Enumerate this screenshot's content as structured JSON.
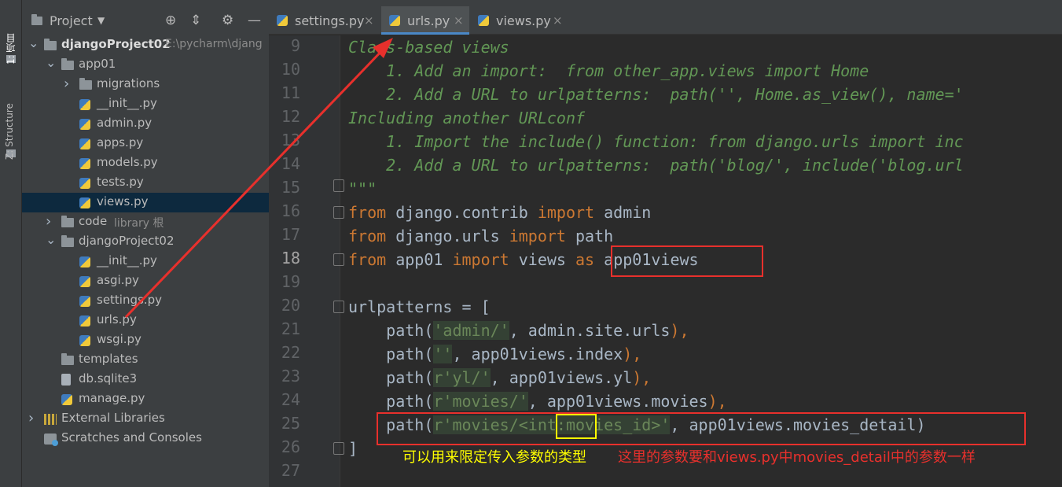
{
  "sidebar_strip": {
    "project_tab": "1: 项目",
    "structure_tab": "Z: Structure"
  },
  "project_panel": {
    "title": "Project",
    "tree": [
      {
        "label": "djangoProject02",
        "extra": "E:\\pycharm\\djang",
        "type": "folder",
        "level": 0,
        "expanded": true
      },
      {
        "label": "app01",
        "type": "folder",
        "level": 1,
        "expanded": true
      },
      {
        "label": "migrations",
        "type": "folder",
        "level": 2,
        "expanded": false
      },
      {
        "label": "__init__.py",
        "type": "py",
        "level": 2
      },
      {
        "label": "admin.py",
        "type": "py",
        "level": 2
      },
      {
        "label": "apps.py",
        "type": "py",
        "level": 2
      },
      {
        "label": "models.py",
        "type": "py",
        "level": 2
      },
      {
        "label": "tests.py",
        "type": "py",
        "level": 2
      },
      {
        "label": "views.py",
        "type": "py",
        "level": 2,
        "selected": true
      },
      {
        "label": "code",
        "extra": "library 根",
        "type": "folder",
        "level": 1,
        "expanded": false
      },
      {
        "label": "djangoProject02",
        "type": "folder",
        "level": 1,
        "expanded": true
      },
      {
        "label": "__init__.py",
        "type": "py",
        "level": 2
      },
      {
        "label": "asgi.py",
        "type": "py",
        "level": 2
      },
      {
        "label": "settings.py",
        "type": "py",
        "level": 2
      },
      {
        "label": "urls.py",
        "type": "py",
        "level": 2
      },
      {
        "label": "wsgi.py",
        "type": "py",
        "level": 2
      },
      {
        "label": "templates",
        "type": "folder",
        "level": 1
      },
      {
        "label": "db.sqlite3",
        "type": "db",
        "level": 1
      },
      {
        "label": "manage.py",
        "type": "py",
        "level": 1
      },
      {
        "label": "External Libraries",
        "type": "lib",
        "level": 0,
        "expanded": false
      },
      {
        "label": "Scratches and Consoles",
        "type": "scratch",
        "level": 0
      }
    ]
  },
  "tabs": [
    {
      "label": "settings.py",
      "active": false
    },
    {
      "label": "urls.py",
      "active": true
    },
    {
      "label": "views.py",
      "active": false
    }
  ],
  "editor": {
    "current_line": 18,
    "lines": [
      {
        "n": 9,
        "segs": [
          {
            "t": "Class-based views",
            "c": "doc"
          }
        ]
      },
      {
        "n": 10,
        "segs": [
          {
            "t": "    1. Add an import:  from other_app.views import Home",
            "c": "doc"
          }
        ]
      },
      {
        "n": 11,
        "segs": [
          {
            "t": "    2. Add a URL to urlpatterns:  path('', Home.as_view(), name='",
            "c": "doc"
          }
        ]
      },
      {
        "n": 12,
        "segs": [
          {
            "t": "Including another URLconf",
            "c": "doc"
          }
        ]
      },
      {
        "n": 13,
        "segs": [
          {
            "t": "    1. Import the include() function: from django.urls import inc",
            "c": "doc"
          }
        ]
      },
      {
        "n": 14,
        "segs": [
          {
            "t": "    2. Add a URL to urlpatterns:  path('blog/', include('blog.url",
            "c": "doc"
          }
        ]
      },
      {
        "n": 15,
        "segs": [
          {
            "t": "\"\"\"",
            "c": "doc"
          }
        ]
      },
      {
        "n": 16,
        "segs": [
          {
            "t": "from",
            "c": "kw"
          },
          {
            "t": " django.contrib ",
            "c": "tx"
          },
          {
            "t": "import",
            "c": "kw"
          },
          {
            "t": " admin",
            "c": "tx"
          }
        ]
      },
      {
        "n": 17,
        "segs": [
          {
            "t": "from",
            "c": "kw"
          },
          {
            "t": " django.urls ",
            "c": "tx"
          },
          {
            "t": "import",
            "c": "kw"
          },
          {
            "t": " path",
            "c": "tx"
          }
        ]
      },
      {
        "n": 18,
        "segs": [
          {
            "t": "from",
            "c": "kw"
          },
          {
            "t": " app01 ",
            "c": "tx"
          },
          {
            "t": "import",
            "c": "kw"
          },
          {
            "t": " views ",
            "c": "tx"
          },
          {
            "t": "as",
            "c": "kw"
          },
          {
            "t": " app01views",
            "c": "tx"
          }
        ]
      },
      {
        "n": 19,
        "segs": []
      },
      {
        "n": 20,
        "segs": [
          {
            "t": "urlpatterns = [",
            "c": "tx"
          }
        ]
      },
      {
        "n": 21,
        "segs": [
          {
            "t": "    path(",
            "c": "tx"
          },
          {
            "t": "'admin/'",
            "c": "st"
          },
          {
            "t": ", admin.site.urls",
            "c": "tx"
          },
          {
            "t": "),",
            "c": "kw"
          }
        ]
      },
      {
        "n": 22,
        "segs": [
          {
            "t": "    path(",
            "c": "tx"
          },
          {
            "t": "''",
            "c": "st"
          },
          {
            "t": ", app01views.index",
            "c": "tx"
          },
          {
            "t": "),",
            "c": "kw"
          }
        ]
      },
      {
        "n": 23,
        "segs": [
          {
            "t": "    path(",
            "c": "tx"
          },
          {
            "t": "r'yl/'",
            "c": "st"
          },
          {
            "t": ", app01views.yl",
            "c": "tx"
          },
          {
            "t": "),",
            "c": "kw"
          }
        ]
      },
      {
        "n": 24,
        "segs": [
          {
            "t": "    path(",
            "c": "tx"
          },
          {
            "t": "r'movies/'",
            "c": "st"
          },
          {
            "t": ", app01views.movies",
            "c": "tx"
          },
          {
            "t": "),",
            "c": "kw"
          }
        ]
      },
      {
        "n": 25,
        "segs": [
          {
            "t": "    path(",
            "c": "tx"
          },
          {
            "t": "r'movies/<int:movies_id>'",
            "c": "st"
          },
          {
            "t": ", app01views.movies_detail)",
            "c": "tx"
          }
        ]
      },
      {
        "n": 26,
        "segs": [
          {
            "t": "]",
            "c": "tx"
          }
        ]
      },
      {
        "n": 27,
        "segs": []
      }
    ]
  },
  "annotations": {
    "type_note": "可以用来限定传入参数的类型",
    "param_note": "这里的参数要和views.py中movies_detail中的参数一样",
    "color_red": "#e8302c",
    "color_yellow": "#ffff00"
  }
}
